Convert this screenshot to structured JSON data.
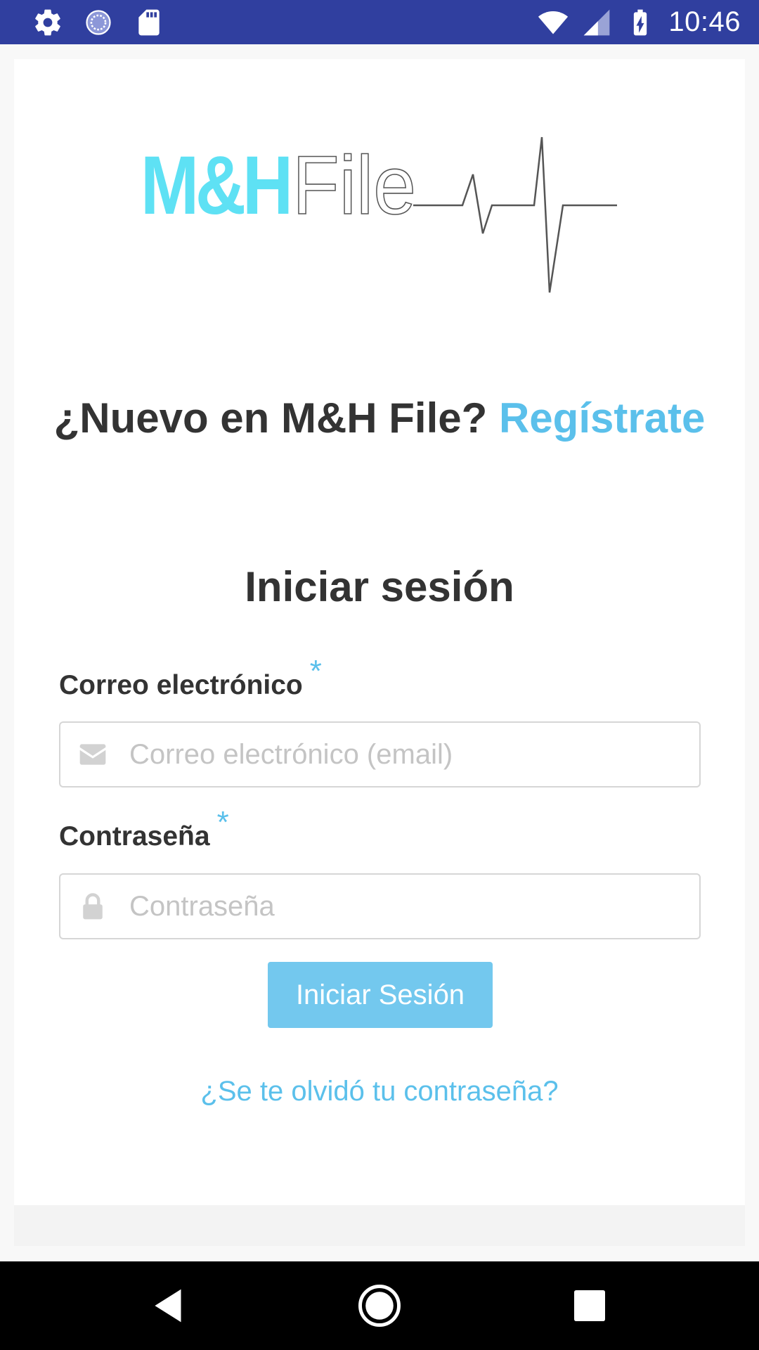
{
  "status_bar": {
    "time": "10:46",
    "left_icons": [
      "settings-icon",
      "sync-icon",
      "sd-card-icon"
    ],
    "right_icons": [
      "wifi-icon",
      "signal-icon",
      "battery-charging-icon"
    ],
    "background": "#303f9f"
  },
  "logo": {
    "brand_part": "M&H",
    "file_part": "File",
    "brand_color": "#5ee1f4"
  },
  "signup": {
    "question": "¿Nuevo en M&H File? ",
    "link": "Regístrate"
  },
  "login": {
    "title": "Iniciar sesión",
    "email_label": "Correo electrónico",
    "email_required": "*",
    "email_placeholder": "Correo electrónico (email)",
    "email_value": "",
    "password_label": "Contraseña",
    "password_required": "*",
    "password_placeholder": "Contraseña",
    "password_value": "",
    "submit_label": "Iniciar Sesión",
    "forgot_link": "¿Se te olvidó tu contraseña?"
  },
  "colors": {
    "accent": "#5bc0eb",
    "button": "#73c8ee",
    "text": "#333333"
  },
  "nav_bar": {
    "icons": [
      "back-icon",
      "home-icon",
      "recents-icon"
    ]
  }
}
